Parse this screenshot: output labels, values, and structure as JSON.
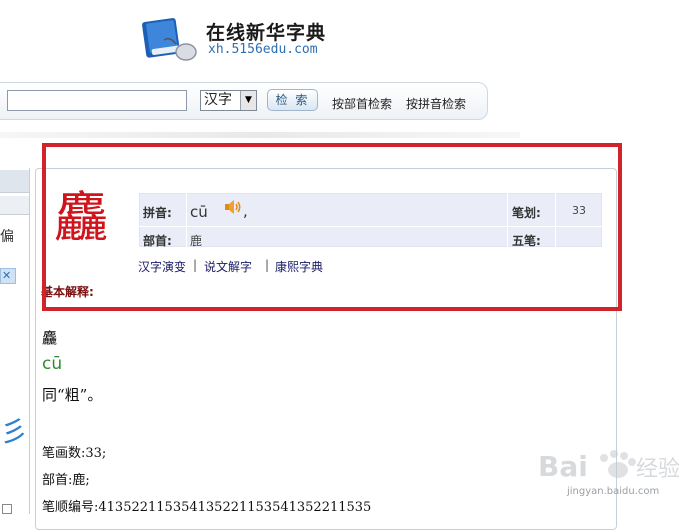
{
  "header": {
    "site_title": "在线新华字典",
    "site_url": "xh.5156edu.com"
  },
  "search": {
    "input_value": "",
    "type_selected": "汉字",
    "button_label": "检 索",
    "links": [
      "按部首检索",
      "按拼音检索"
    ]
  },
  "sidebar": {
    "partial_char": "偏",
    "ad_mark": "✕",
    "blue_glyph": "彡"
  },
  "entry": {
    "character": "麤",
    "labels": {
      "pinyin": "拼音:",
      "radical": "部首:",
      "strokes": "笔划:",
      "wubi": "五笔:"
    },
    "pinyin": "cū",
    "comma": ",",
    "radical": "鹿",
    "strokes": "33",
    "wubi": "",
    "links": [
      "汉字演变",
      "说文解字",
      "康熙字典"
    ],
    "separator": "|",
    "basic_heading": "基本解释:"
  },
  "definition": {
    "char": "麤",
    "pinyin": "cū",
    "meaning": "同“粗”。",
    "stroke_count": "笔画数:33;",
    "radical_line": "部首:鹿;",
    "stroke_order": "笔顺编号:413522115354135221153541352211535"
  },
  "watermark": {
    "brand": "Baidu经验",
    "url": "jingyan.baidu.com"
  },
  "colors": {
    "highlight_frame": "#d2232a",
    "character_red": "#d0141b",
    "pinyin_green": "#2e8b2e",
    "info_bg": "#eaedf8"
  }
}
